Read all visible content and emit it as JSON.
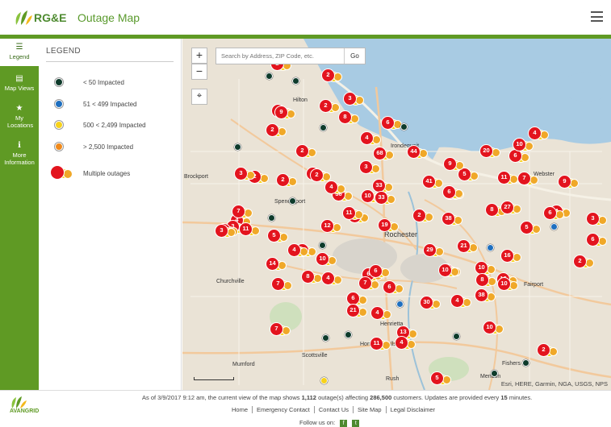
{
  "header": {
    "logo_text": "RG&E",
    "title": "Outage Map"
  },
  "sidenav": [
    {
      "id": "legend",
      "icon": "list-icon",
      "glyph": "☰",
      "label": "Legend",
      "active": true
    },
    {
      "id": "map-views",
      "icon": "layers-icon",
      "glyph": "▤",
      "label": "Map Views"
    },
    {
      "id": "my-locations",
      "icon": "star-icon",
      "glyph": "★",
      "label": "My Locations"
    },
    {
      "id": "more-info",
      "icon": "info-icon",
      "glyph": "ℹ",
      "label": "More Information"
    }
  ],
  "legend": {
    "title": "LEGEND",
    "items": [
      {
        "label": "< 50 Impacted",
        "color": "#0e3b2b"
      },
      {
        "label": "51 < 499 Impacted",
        "color": "#1e6fbf"
      },
      {
        "label": "500 < 2,499 Impacted",
        "color": "#f7d21a"
      },
      {
        "label": "> 2,500 Impacted",
        "color": "#f08a1c"
      }
    ],
    "multiple_label": "Multiple outages"
  },
  "map": {
    "search_placeholder": "Search by Address, ZIP Code, etc.",
    "search_button": "Go",
    "zoom_in": "+",
    "zoom_out": "−",
    "locate_icon": "crosshair-icon",
    "attribution": "Esri, HERE, Garmin, NGA, USGS, NPS",
    "place_labels": [
      "Hilton",
      "Spencerport",
      "Brockport",
      "Churchville",
      "Rochester",
      "Irondequoit",
      "Webster",
      "Fairport",
      "Henrietta",
      "Scottsville",
      "Mumford",
      "Rush",
      "Mendon",
      "Fishers",
      "Honeoye Falls"
    ],
    "clusters": [
      "2",
      "2",
      "2",
      "3",
      "2",
      "9",
      "8",
      "6",
      "2",
      "4",
      "2",
      "68",
      "44",
      "3",
      "2",
      "8",
      "20",
      "6",
      "4",
      "10",
      "3",
      "2",
      "36",
      "5",
      "11",
      "7",
      "9",
      "4",
      "2",
      "10",
      "33",
      "41",
      "9",
      "21",
      "6",
      "33",
      "8",
      "27",
      "11",
      "38",
      "4",
      "3",
      "19",
      "4",
      "6",
      "3",
      "12",
      "11",
      "2",
      "3",
      "7",
      "5",
      "10",
      "21",
      "11",
      "4",
      "10",
      "5",
      "4",
      "6",
      "7",
      "29",
      "10",
      "16",
      "14",
      "8",
      "4",
      "7",
      "10",
      "16",
      "6",
      "10",
      "2",
      "8",
      "16",
      "6",
      "38",
      "6",
      "4",
      "30",
      "21",
      "4",
      "7",
      "10",
      "13",
      "11",
      "4",
      "2",
      "5",
      "3",
      "6",
      "3"
    ],
    "dots": [
      "#0e3b2b",
      "#0e3b2b",
      "#0e3b2b",
      "#0e3b2b",
      "#0e3b2b",
      "#0e3b2b",
      "#1e6fbf",
      "#0e3b2b",
      "#1e6fbf",
      "#1e6fbf",
      "#0e3b2b",
      "#0e3b2b",
      "#0e3b2b",
      "#0e3b2b",
      "#0e3b2b",
      "#f7d21a",
      "#0e3b2b"
    ]
  },
  "footer": {
    "status_prefix": "As of 3/9/2017 9:12 am, the current view of the map shows",
    "outage_count": "1,112",
    "status_mid": "outage(s) affecting",
    "customer_count": "286,500",
    "status_mid2": "customers. Updates are provided every",
    "interval": "15",
    "status_suffix": "minutes.",
    "links": [
      "Home",
      "Emergency Contact",
      "Contact Us",
      "Site Map",
      "Legal Disclaimer"
    ],
    "follow_label": "Follow us on:",
    "brand": "AVANGRID"
  }
}
